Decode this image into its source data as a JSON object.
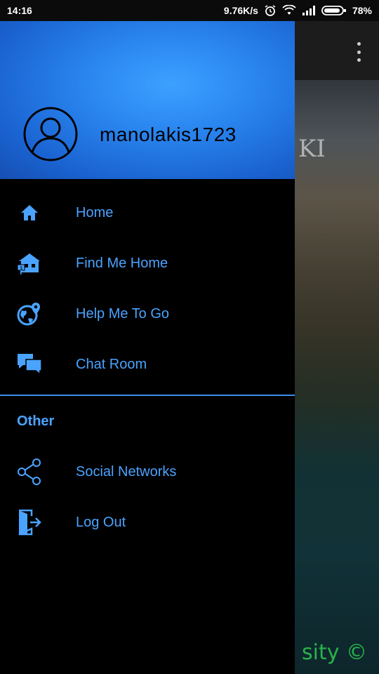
{
  "status_bar": {
    "time": "14:16",
    "network_speed": "9.76K/s",
    "battery": "78%",
    "icons": [
      "alarm-icon",
      "wifi-icon",
      "signal-icon",
      "battery-icon"
    ]
  },
  "drawer": {
    "username": "manolakis1723",
    "main_items": [
      {
        "label": "Home",
        "icon": "home-icon"
      },
      {
        "label": "Find Me Home",
        "icon": "house-for-sale-icon"
      },
      {
        "label": "Help Me To Go",
        "icon": "globe-pin-icon"
      },
      {
        "label": "Chat Room",
        "icon": "chat-bubbles-icon"
      }
    ],
    "section_title": "Other",
    "other_items": [
      {
        "label": "Social Networks",
        "icon": "share-icon"
      },
      {
        "label": "Log Out",
        "icon": "logout-icon"
      }
    ]
  },
  "background": {
    "overlay_text": "KI",
    "watermark": "sity ©"
  },
  "colors": {
    "accent": "#4aa3ff",
    "header_blue": "#2a86f0",
    "divider": "#3b8fe8",
    "drawer_bg": "#000000"
  }
}
